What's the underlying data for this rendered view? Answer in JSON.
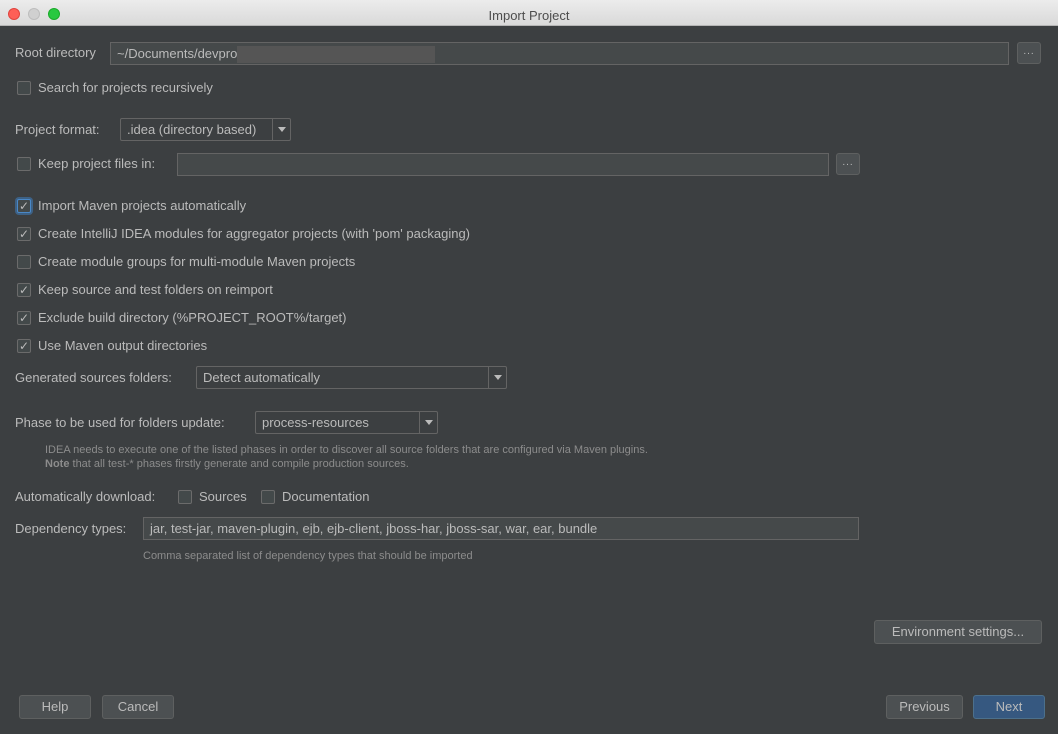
{
  "window": {
    "title": "Import Project"
  },
  "root_directory": {
    "label": "Root directory",
    "value": "~/Documents/devpro",
    "browse": "..."
  },
  "search_recursively": {
    "label": "Search for projects recursively",
    "checked": false
  },
  "project_format": {
    "label": "Project format:",
    "selected": ".idea (directory based)"
  },
  "keep_project_files": {
    "label": "Keep project files in:",
    "checked": false,
    "value": "",
    "browse": "..."
  },
  "maven_options": [
    {
      "label": "Import Maven projects automatically",
      "checked": true
    },
    {
      "label": "Create IntelliJ IDEA modules for aggregator projects (with 'pom' packaging)",
      "checked": true
    },
    {
      "label": "Create module groups for multi-module Maven projects",
      "checked": false
    },
    {
      "label": "Keep source and test folders on reimport",
      "checked": true
    },
    {
      "label": "Exclude build directory (%PROJECT_ROOT%/target)",
      "checked": true
    },
    {
      "label": "Use Maven output directories",
      "checked": true
    }
  ],
  "generated_sources": {
    "label": "Generated sources folders:",
    "selected": "Detect automatically"
  },
  "phase": {
    "label": "Phase to be used for folders update:",
    "selected": "process-resources",
    "hint_line1": "IDEA needs to execute one of the listed phases in order to discover all source folders that are configured via Maven plugins.",
    "hint_note_bold": "Note",
    "hint_line2": " that all test-* phases firstly generate and compile production sources."
  },
  "auto_download": {
    "label": "Automatically download:",
    "sources": {
      "label": "Sources",
      "checked": false
    },
    "documentation": {
      "label": "Documentation",
      "checked": false
    }
  },
  "dependency_types": {
    "label": "Dependency types:",
    "value": "jar, test-jar, maven-plugin, ejb, ejb-client, jboss-har, jboss-sar, war, ear, bundle",
    "hint": "Comma separated list of dependency types that should be imported"
  },
  "buttons": {
    "environment_settings": "Environment settings...",
    "help": "Help",
    "cancel": "Cancel",
    "previous": "Previous",
    "next": "Next"
  },
  "colors": {
    "background": "#3c3f41",
    "text": "#bbbbbb",
    "primary_button": "#365880",
    "focus": "#4a88c7"
  }
}
